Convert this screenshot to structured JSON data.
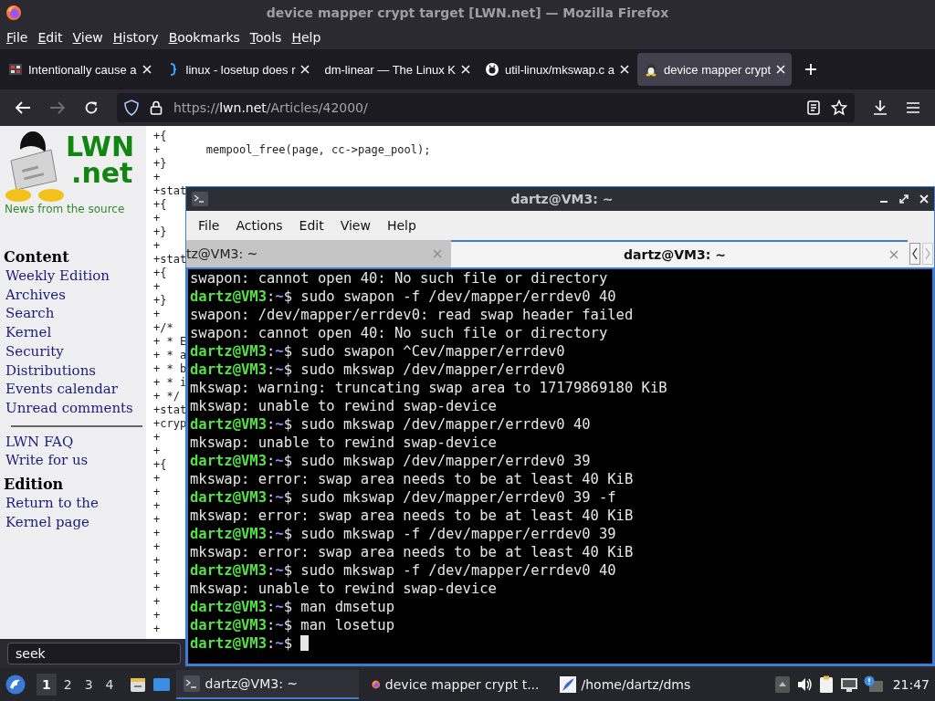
{
  "browser": {
    "title": "device mapper crypt target [LWN.net] — Mozilla Firefox",
    "menu": [
      "File",
      "Edit",
      "View",
      "History",
      "Bookmarks",
      "Tools",
      "Help"
    ],
    "tabs": [
      {
        "label": "Intentionally cause a",
        "selected": false
      },
      {
        "label": "linux - losetup does r",
        "selected": false
      },
      {
        "label": "dm-linear — The Linux K",
        "selected": false
      },
      {
        "label": "util-linux/mkswap.c a",
        "selected": false
      },
      {
        "label": "device mapper crypt",
        "selected": true
      }
    ],
    "url": {
      "scheme": "https://",
      "host": "lwn.net",
      "path": "/Articles/42000/"
    },
    "back_disabled": false,
    "forward_disabled": true,
    "find": {
      "value": "seek"
    }
  },
  "sidebar": {
    "logo_top": "LWN",
    "logo_bottom": ".net",
    "tagline": "News from the source",
    "sections": [
      {
        "kind": "links",
        "heading": "Content",
        "links": [
          "Weekly Edition",
          "Archives",
          "Search",
          "Kernel",
          "Security",
          "Distributions",
          "Events calendar",
          "Unread comments"
        ]
      },
      {
        "kind": "divider"
      },
      {
        "kind": "links",
        "links": [
          "LWN FAQ",
          "Write for us"
        ]
      },
      {
        "kind": "links",
        "heading": "Edition",
        "links": [
          "Return to the Kernel page"
        ]
      }
    ]
  },
  "code_lines": [
    "+{",
    "+\tmempool_free(page, cc->page_pool);",
    "+}",
    "+",
    "+stat",
    "+{",
    "+",
    "+}",
    "+",
    "+stat",
    "+{",
    "+",
    "+}",
    "+",
    "+/*",
    "+ * E",
    "+ * a",
    "+ * b",
    "+ * i",
    "+ */",
    "+stat",
    "+cryp",
    "+",
    "+",
    "+{",
    "+",
    "+",
    "+",
    "+",
    "+",
    "+",
    "+",
    "+",
    "+",
    "+",
    "+",
    "+"
  ],
  "terminal": {
    "title": "dartz@VM3: ~",
    "menu": [
      "File",
      "Actions",
      "Edit",
      "View",
      "Help"
    ],
    "tabs": [
      {
        "label": "tz@VM3: ~",
        "selected": false
      },
      {
        "label": "dartz@VM3: ~",
        "selected": true
      }
    ],
    "lines": [
      {
        "kind": "output",
        "text": "swapon: cannot open 40: No such file or directory"
      },
      {
        "kind": "prompt",
        "user": "dartz@VM3",
        "sep": ":",
        "path": "~",
        "sign": "$",
        "command": "sudo swapon -f /dev/mapper/errdev0 40"
      },
      {
        "kind": "output",
        "text": "swapon: /dev/mapper/errdev0: read swap header failed"
      },
      {
        "kind": "output",
        "text": "swapon: cannot open 40: No such file or directory"
      },
      {
        "kind": "prompt",
        "user": "dartz@VM3",
        "sep": ":",
        "path": "~",
        "sign": "$",
        "command": "sudo swapon ^Cev/mapper/errdev0"
      },
      {
        "kind": "prompt",
        "user": "dartz@VM3",
        "sep": ":",
        "path": "~",
        "sign": "$",
        "command": "sudo mkswap /dev/mapper/errdev0"
      },
      {
        "kind": "output",
        "text": "mkswap: warning: truncating swap area to 17179869180 KiB"
      },
      {
        "kind": "output",
        "text": "mkswap: unable to rewind swap-device"
      },
      {
        "kind": "prompt",
        "user": "dartz@VM3",
        "sep": ":",
        "path": "~",
        "sign": "$",
        "command": "sudo mkswap /dev/mapper/errdev0 40"
      },
      {
        "kind": "output",
        "text": "mkswap: unable to rewind swap-device"
      },
      {
        "kind": "prompt",
        "user": "dartz@VM3",
        "sep": ":",
        "path": "~",
        "sign": "$",
        "command": "sudo mkswap /dev/mapper/errdev0 39"
      },
      {
        "kind": "output",
        "text": "mkswap: error: swap area needs to be at least 40 KiB"
      },
      {
        "kind": "prompt",
        "user": "dartz@VM3",
        "sep": ":",
        "path": "~",
        "sign": "$",
        "command": "sudo mkswap /dev/mapper/errdev0 39 -f"
      },
      {
        "kind": "output",
        "text": "mkswap: error: swap area needs to be at least 40 KiB"
      },
      {
        "kind": "prompt",
        "user": "dartz@VM3",
        "sep": ":",
        "path": "~",
        "sign": "$",
        "command": "sudo mkswap -f /dev/mapper/errdev0 39"
      },
      {
        "kind": "output",
        "text": "mkswap: error: swap area needs to be at least 40 KiB"
      },
      {
        "kind": "prompt",
        "user": "dartz@VM3",
        "sep": ":",
        "path": "~",
        "sign": "$",
        "command": "sudo mkswap -f /dev/mapper/errdev0 40"
      },
      {
        "kind": "output",
        "text": "mkswap: unable to rewind swap-device"
      },
      {
        "kind": "prompt",
        "user": "dartz@VM3",
        "sep": ":",
        "path": "~",
        "sign": "$",
        "command": "man dmsetup"
      },
      {
        "kind": "prompt",
        "user": "dartz@VM3",
        "sep": ":",
        "path": "~",
        "sign": "$",
        "command": "man losetup"
      },
      {
        "kind": "prompt",
        "user": "dartz@VM3",
        "sep": ":",
        "path": "~",
        "sign": "$",
        "cursor": true
      }
    ]
  },
  "taskbar": {
    "workspaces": [
      {
        "label": "1",
        "selected": true
      },
      {
        "label": "2",
        "selected": false
      },
      {
        "label": "3",
        "selected": false
      },
      {
        "label": "4",
        "selected": false
      }
    ],
    "tasks": [
      {
        "label": "dartz@VM3: ~",
        "selected": true
      },
      {
        "label": "device mapper crypt t...",
        "selected": false
      },
      {
        "label": "/home/dartz/dms",
        "selected": false
      }
    ],
    "clock": "21:47"
  }
}
